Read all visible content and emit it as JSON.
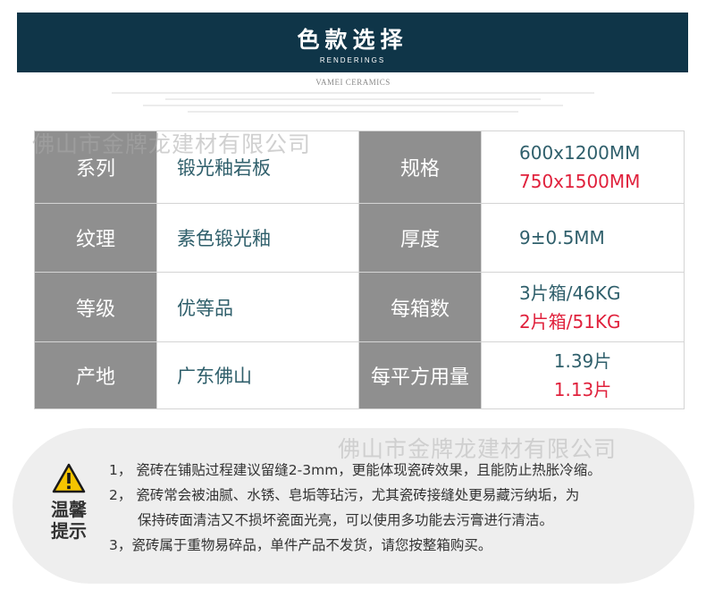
{
  "banner": {
    "title": "色款选择",
    "subtitle": "RENDERINGS"
  },
  "brand": "VAMEI CERAMICS",
  "watermark": "佛山市金牌龙建材有限公司",
  "specs": {
    "rows": [
      {
        "label_left": "系列",
        "value_left": "锻光釉岩板",
        "label_right": "规格",
        "value_right_1": "600x1200MM",
        "value_right_2": "750x1500MM"
      },
      {
        "label_left": "纹理",
        "value_left": "素色锻光釉",
        "label_right": "厚度",
        "value_right_1": "9±0.5MM"
      },
      {
        "label_left": "等级",
        "value_left": "优等品",
        "label_right": "每箱数",
        "value_right_1": "3片箱/46KG",
        "value_right_2": "2片箱/51KG"
      },
      {
        "label_left": "产地",
        "value_left": "广东佛山",
        "label_right": "每平方用量",
        "value_right_1": "1.39片",
        "value_right_2": "1.13片"
      }
    ]
  },
  "notice": {
    "title_line1": "温馨",
    "title_line2": "提示",
    "icon": "warning-icon",
    "notes": [
      "1， 瓷砖在铺贴过程建议留缝2-3mm，更能体现瓷砖效果，且能防止热胀冷缩。",
      "2， 瓷砖常会被油腻、水锈、皂垢等玷污，尤其瓷砖接缝处更易藏污纳垢，为",
      "保持砖面清洁又不损坏瓷面光亮，可以使用多功能去污膏进行清洁。",
      "3，瓷砖属于重物易碎品，单件产品不发货，请您按整箱购买。"
    ]
  },
  "colors": {
    "banner": "#0f3548",
    "label_bg": "#8f8f8f",
    "value_text": "#2f5f6b",
    "accent_red": "#e0213c"
  }
}
